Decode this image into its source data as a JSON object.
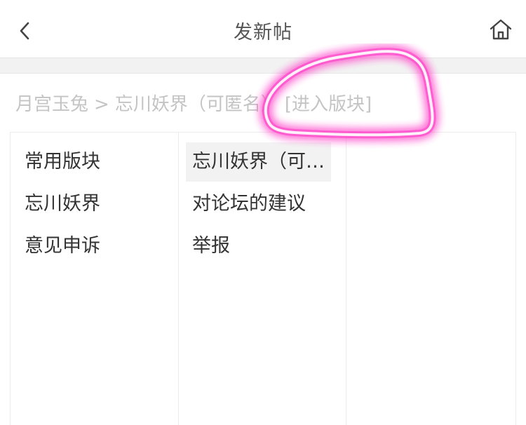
{
  "header": {
    "title": "发新帖",
    "back_icon": "chevron-left-icon",
    "home_icon": "home-icon"
  },
  "breadcrumb": {
    "parent": "月宫玉兔",
    "separator": ">",
    "current": "忘川妖界（可匿名）",
    "enter_link": "[进入版块]"
  },
  "columns": {
    "first": [
      "常用版块",
      "忘川妖界",
      "意见申诉"
    ],
    "second": [
      "忘川妖界（可匿名）",
      "对论坛的建议",
      "举报"
    ],
    "second_selected_index": 0
  },
  "annotation": {
    "color": "#ff3fc8",
    "type": "freehand-circle"
  }
}
